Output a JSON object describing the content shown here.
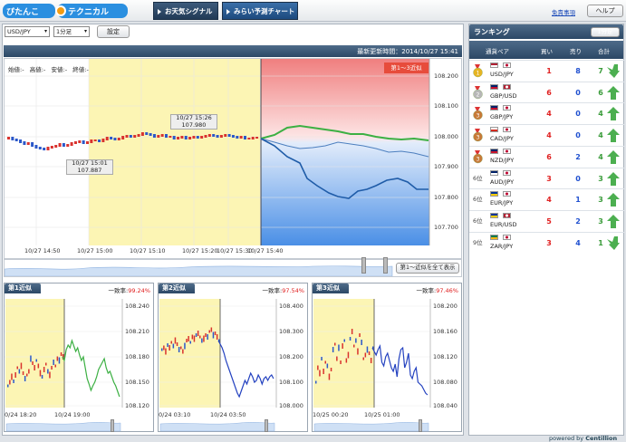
{
  "header": {
    "logo_left": "ぴたんこ",
    "logo_right": "テクニカル",
    "tabs": [
      "お天気シグナル",
      "みらい予測チャート"
    ],
    "disclaimer": "免責事項",
    "help": "ヘルプ"
  },
  "controls": {
    "pair": "USD/JPY",
    "interval": "1分足",
    "settings": "設定"
  },
  "main": {
    "updated_label": "最新更新時間：",
    "updated_value": "2014/10/27 15:41",
    "ohlc": [
      {
        "label": "始値",
        "value": "-"
      },
      {
        "label": "高値",
        "value": "-"
      },
      {
        "label": "安値",
        "value": "-"
      },
      {
        "label": "終値",
        "value": "-"
      }
    ],
    "forecast_tag": "第1〜3近似",
    "yticks": [
      "108.200",
      "108.100",
      "108.000",
      "107.900",
      "107.800",
      "107.700",
      "107.600"
    ],
    "xticks": [
      "10/27 14:50",
      "10/27 15:00",
      "10/27 15:10",
      "10/27 15:20",
      "10/27 15:30",
      "10/27 15:40"
    ],
    "high_tip": {
      "time": "10/27 15:26",
      "value": "107.980"
    },
    "low_tip": {
      "time": "10/27 15:01",
      "value": "107.887"
    },
    "show_all": "第1〜近似を全て表示"
  },
  "similar": [
    {
      "title": "第1近似",
      "match_label": "一致率:",
      "match_value": "99.24%",
      "yticks": [
        "108.240",
        "108.210",
        "108.180",
        "108.150",
        "108.120"
      ],
      "xticks": [
        "0/24 18:20",
        "10/24 19:00"
      ]
    },
    {
      "title": "第2近似",
      "match_label": "一致率:",
      "match_value": "97.54%",
      "yticks": [
        "108.400",
        "108.300",
        "108.200",
        "108.100",
        "108.000"
      ],
      "xticks": [
        "0/24 03:10",
        "10/24 03:50"
      ]
    },
    {
      "title": "第3近似",
      "match_label": "一致率:",
      "match_value": "97.46%",
      "yticks": [
        "108.200",
        "108.160",
        "108.120",
        "108.080",
        "108.040"
      ],
      "xticks": [
        "10/25 00:20",
        "10/25 01:00"
      ]
    }
  ],
  "ranking": {
    "title": "ランキング",
    "interval": "1分足",
    "headers": [
      "通貨ペア",
      "買い",
      "売り",
      "合計"
    ],
    "rows": [
      {
        "rank": "1",
        "pair": "USD/JPY",
        "buy": "1",
        "sell": "8",
        "total": "7",
        "dir": "down",
        "medal": "gold"
      },
      {
        "rank": "2",
        "pair": "GBP/USD",
        "buy": "6",
        "sell": "0",
        "total": "6",
        "dir": "up",
        "medal": "silver"
      },
      {
        "rank": "3",
        "pair": "GBP/JPY",
        "buy": "4",
        "sell": "0",
        "total": "4",
        "dir": "up",
        "medal": "bronze"
      },
      {
        "rank": "3",
        "pair": "CAD/JPY",
        "buy": "4",
        "sell": "0",
        "total": "4",
        "dir": "up",
        "medal": "bronze"
      },
      {
        "rank": "3",
        "pair": "NZD/JPY",
        "buy": "6",
        "sell": "2",
        "total": "4",
        "dir": "up",
        "medal": "bronze"
      },
      {
        "rank": "6位",
        "pair": "AUD/JPY",
        "buy": "3",
        "sell": "0",
        "total": "3",
        "dir": "up",
        "medal": ""
      },
      {
        "rank": "6位",
        "pair": "EUR/JPY",
        "buy": "4",
        "sell": "1",
        "total": "3",
        "dir": "up",
        "medal": ""
      },
      {
        "rank": "6位",
        "pair": "EUR/USD",
        "buy": "5",
        "sell": "2",
        "total": "3",
        "dir": "up",
        "medal": ""
      },
      {
        "rank": "9位",
        "pair": "ZAR/JPY",
        "buy": "3",
        "sell": "4",
        "total": "1",
        "dir": "down",
        "medal": ""
      }
    ]
  },
  "footer": {
    "powered": "powered by",
    "brand": "Centillion"
  },
  "colors": {
    "buy": "#e02020",
    "sell": "#2050d0",
    "green": "#3cb043",
    "header": "#2c4866"
  }
}
